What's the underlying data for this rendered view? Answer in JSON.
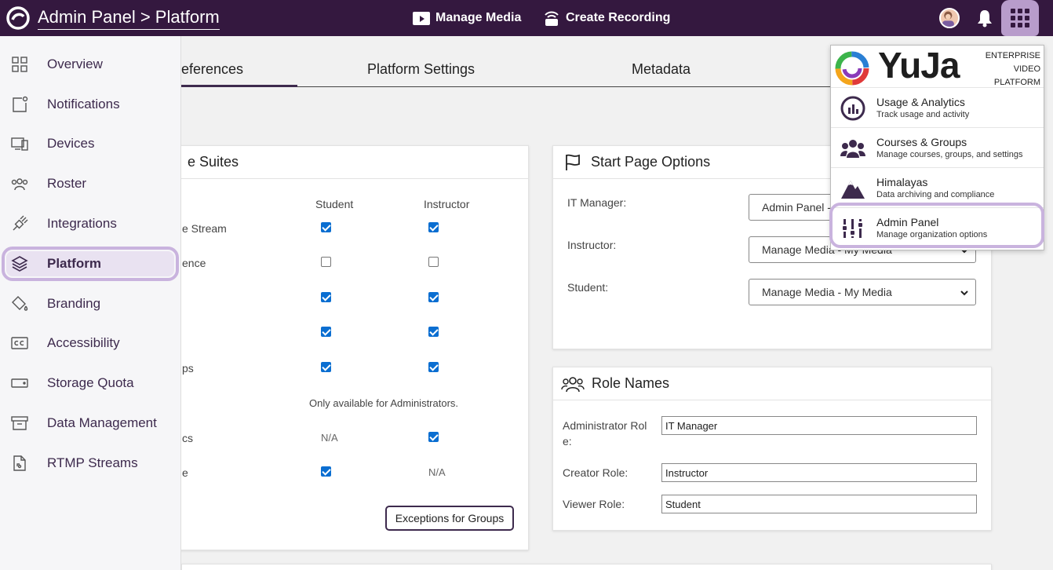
{
  "header": {
    "title": "Admin Panel > Platform",
    "manage_media": "Manage Media",
    "create_recording": "Create Recording"
  },
  "sidebar": {
    "items": [
      {
        "label": "Overview",
        "icon": "grid-icon"
      },
      {
        "label": "Notifications",
        "icon": "notification-icon"
      },
      {
        "label": "Devices",
        "icon": "devices-icon"
      },
      {
        "label": "Roster",
        "icon": "roster-icon"
      },
      {
        "label": "Integrations",
        "icon": "plug-icon"
      },
      {
        "label": "Platform",
        "icon": "layers-icon"
      },
      {
        "label": "Branding",
        "icon": "paint-bucket-icon"
      },
      {
        "label": "Accessibility",
        "icon": "cc-icon"
      },
      {
        "label": "Storage Quota",
        "icon": "storage-icon"
      },
      {
        "label": "Data Management",
        "icon": "archive-icon"
      },
      {
        "label": "RTMP Streams",
        "icon": "stream-file-icon"
      }
    ],
    "active": "Platform"
  },
  "tabs": [
    {
      "label": "eferences"
    },
    {
      "label": "Platform Settings"
    },
    {
      "label": "Metadata"
    }
  ],
  "suites": {
    "title": "e Suites",
    "col_student": "Student",
    "col_instructor": "Instructor",
    "rows": [
      {
        "label": "e Stream"
      },
      {
        "label": "ence"
      },
      {
        "label": ""
      },
      {
        "label": ""
      },
      {
        "label": "ps"
      },
      {
        "label": ""
      },
      {
        "label": "cs"
      },
      {
        "label": "e"
      }
    ],
    "admin_only_note": "Only available for Administrators.",
    "na": "N/A",
    "exceptions_button": "Exceptions for Groups"
  },
  "start_page": {
    "title": "Start Page Options",
    "it_manager_label": "IT Manager:",
    "it_manager_value": "Admin Panel -",
    "instructor_label": "Instructor:",
    "instructor_value": "Manage Media - My Media",
    "student_label": "Student:",
    "student_value": "Manage Media - My Media"
  },
  "role_names": {
    "title": "Role Names",
    "admin_label_1": "Administrator Rol",
    "admin_label_2": "e:",
    "admin_value": "IT Manager",
    "creator_label": "Creator Role:",
    "creator_value": "Instructor",
    "viewer_label": "Viewer Role:",
    "viewer_value": "Student"
  },
  "apps_menu": {
    "brand": "YuJa",
    "brand_sub_1": "ENTERPRISE",
    "brand_sub_2": "VIDEO",
    "brand_sub_3": "PLATFORM",
    "items": [
      {
        "title": "Usage & Analytics",
        "subtitle": "Track usage and activity"
      },
      {
        "title": "Courses & Groups",
        "subtitle": "Manage courses, groups, and settings"
      },
      {
        "title": "Himalayas",
        "subtitle": "Data archiving and compliance"
      },
      {
        "title": "Admin Panel",
        "subtitle": "Manage organization options"
      }
    ]
  },
  "colors": {
    "header_bg": "#34183f",
    "accent": "#3d2a4d",
    "highlight": "#c9b3de",
    "checkbox": "#0a6ed1"
  }
}
